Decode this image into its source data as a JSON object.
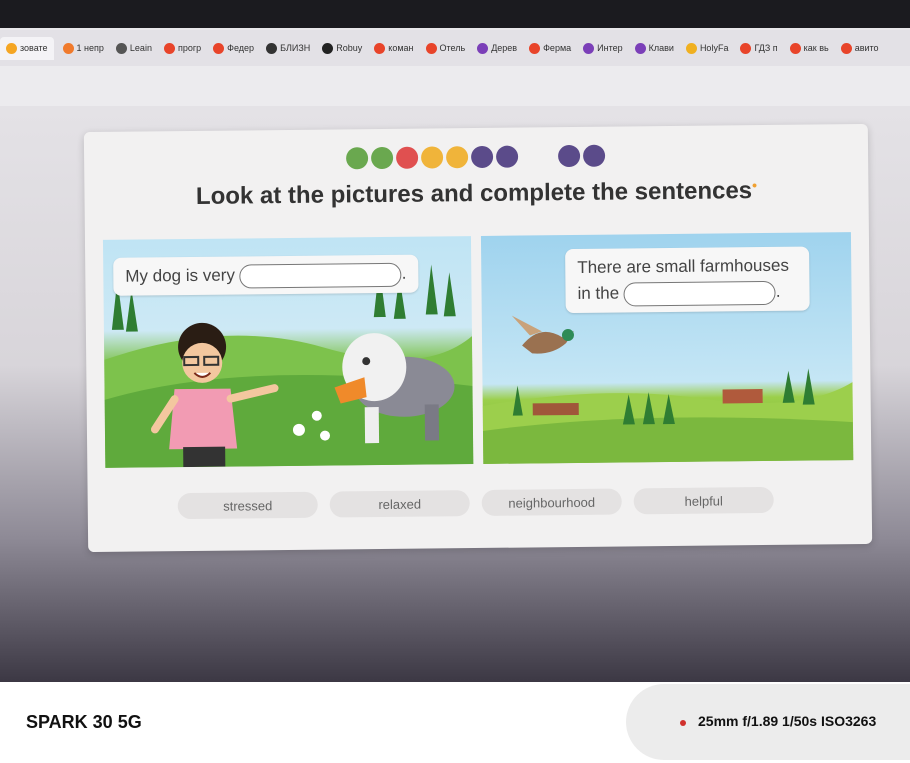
{
  "browser": {
    "tabs": [
      {
        "label": "зовате",
        "color": "#f5a623"
      },
      {
        "label": "1 непр",
        "color": "#f07a2c"
      },
      {
        "label": "Leain",
        "color": "#555555"
      },
      {
        "label": "прогр",
        "color": "#e8442a"
      },
      {
        "label": "Федер",
        "color": "#e8442a"
      },
      {
        "label": "БЛИЗН",
        "color": "#333333"
      },
      {
        "label": "Robuy",
        "color": "#222222"
      },
      {
        "label": "коман",
        "color": "#e8442a"
      },
      {
        "label": "Отель",
        "color": "#e8442a"
      },
      {
        "label": "Дерев",
        "color": "#7b3fb8"
      },
      {
        "label": "Ферма",
        "color": "#e8442a"
      },
      {
        "label": "Интер",
        "color": "#7b3fb8"
      },
      {
        "label": "Клави",
        "color": "#7b3fb8"
      },
      {
        "label": "HolyFa",
        "color": "#f0b020"
      },
      {
        "label": "ГДЗ п",
        "color": "#e8442a"
      },
      {
        "label": "как вь",
        "color": "#e8442a"
      },
      {
        "label": "авито",
        "color": "#e8442a"
      }
    ]
  },
  "exercise": {
    "progress_dots": [
      "#6aa84f",
      "#6aa84f",
      "#e05050",
      "#f0b43a",
      "#f0b43a",
      "#5b4b8a",
      "#5b4b8a",
      "#5b4b8a",
      "#5b4b8a"
    ],
    "title": "Look at the pictures and complete the sentences",
    "sentence_left": {
      "before": "My dog is very",
      "after": "."
    },
    "sentence_right": {
      "line1": "There are small farmhouses",
      "before": "in the",
      "after": "."
    },
    "options": [
      "stressed",
      "relaxed",
      "neighbourhood",
      "helpful"
    ]
  },
  "camera": {
    "device": "SPARK 30 5G",
    "exif": "25mm f/1.89 1/50s ISO3263"
  }
}
